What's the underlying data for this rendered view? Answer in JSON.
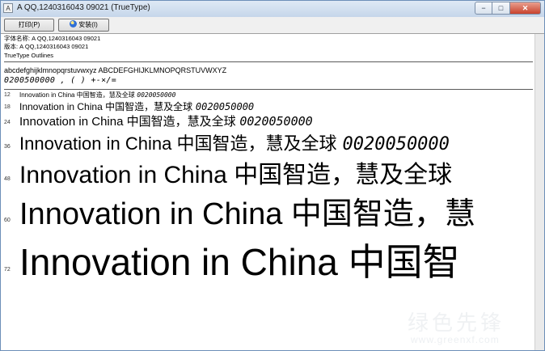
{
  "window": {
    "title": "A QQ,1240316043  09021 (TrueType)",
    "buttons": {
      "minimize": "−",
      "maximize": "□",
      "close": "✕"
    }
  },
  "toolbar": {
    "print_label": "打印(P)",
    "install_label": "安装(I)"
  },
  "font_info": {
    "name_line": "字体名称: A QQ,1240316043  09021",
    "version_line": "版本: A QQ,1240316043  09021",
    "type_line": "TrueType Outlines"
  },
  "charset": {
    "alphabet": "abcdefghijklmnopqrstuvwxyz ABCDEFGHIJKLMNOPQRSTUVWXYZ",
    "digits_symbols": "0200500000  ,   (   ) +-×/="
  },
  "samples": [
    {
      "size": "12",
      "latin": "Innovation in China ",
      "cjk": "中国智造，慧及全球 ",
      "digits": "0020050000"
    },
    {
      "size": "18",
      "latin": "Innovation in China ",
      "cjk": "中国智造，慧及全球 ",
      "digits": "0020050000"
    },
    {
      "size": "24",
      "latin": "Innovation in China ",
      "cjk": "中国智造，慧及全球 ",
      "digits": "0020050000"
    },
    {
      "size": "36",
      "latin": "Innovation in China ",
      "cjk": "中国智造，慧及全球 ",
      "digits": "0020050000"
    },
    {
      "size": "48",
      "latin": "Innovation in China ",
      "cjk": "中国智造，慧及全球",
      "digits": ""
    },
    {
      "size": "60",
      "latin": "Innovation in China ",
      "cjk": "中国智造，慧",
      "digits": ""
    },
    {
      "size": "72",
      "latin": "Innovation in China ",
      "cjk": "中国智",
      "digits": ""
    }
  ],
  "watermark": {
    "top": "绿色先锋",
    "bottom": "www.greenxf.com"
  }
}
